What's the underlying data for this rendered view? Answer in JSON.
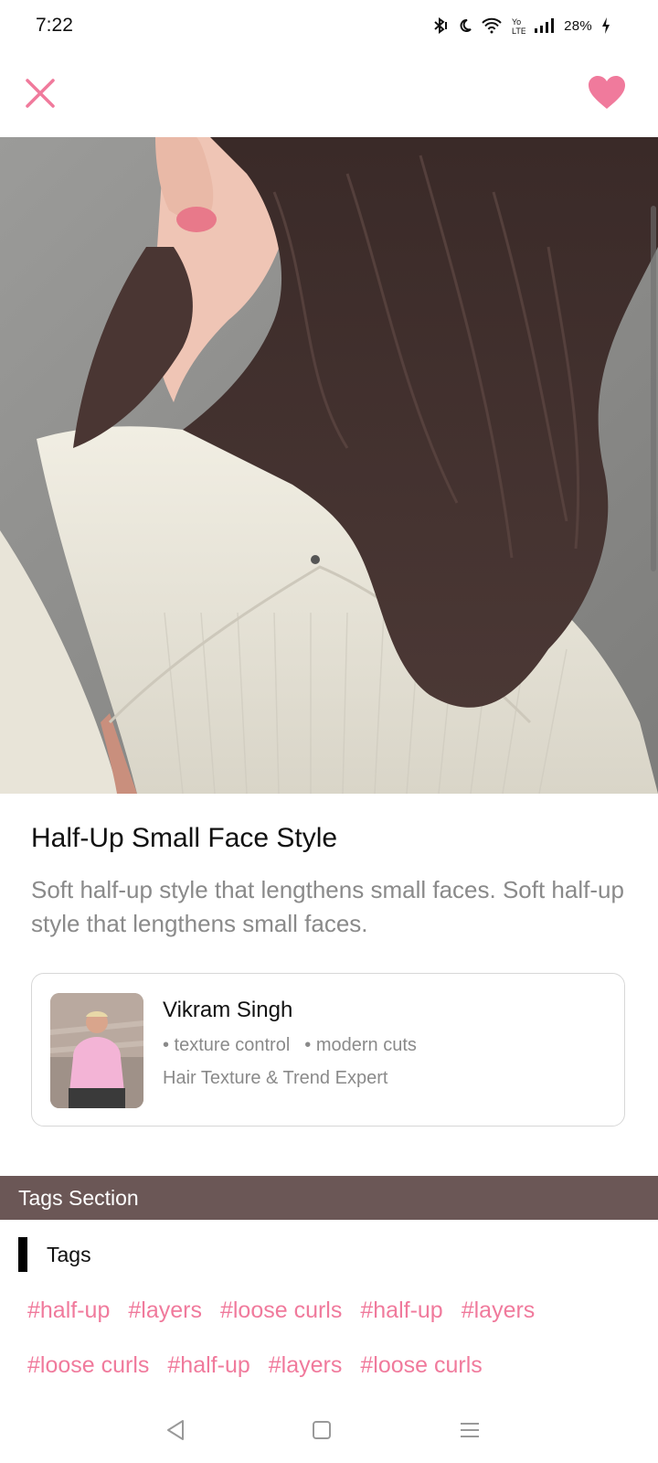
{
  "status": {
    "time": "7:22",
    "battery": "28%"
  },
  "top_bar": {
    "close_icon": "close-icon",
    "favorite_icon": "heart-icon",
    "accent_color": "#f07a9c"
  },
  "style": {
    "title": "Half-Up Small Face Style",
    "description": "Soft half-up style that lengthens small faces. Soft half-up style that lengthens small faces."
  },
  "stylist": {
    "name": "Vikram Singh",
    "specialties": [
      "• texture control",
      "• modern cuts"
    ],
    "role": "Hair Texture & Trend Expert"
  },
  "tags_section": {
    "header": "Tags Section",
    "label": "Tags",
    "tags": [
      "#half-up",
      "#layers",
      "#loose curls",
      "#half-up",
      "#layers",
      "#loose curls",
      "#half-up",
      "#layers",
      "#loose curls"
    ],
    "header_color": "#6b5756"
  },
  "nav": {
    "back_icon": "back-triangle-icon",
    "home_icon": "home-square-icon",
    "menu_icon": "menu-lines-icon"
  }
}
